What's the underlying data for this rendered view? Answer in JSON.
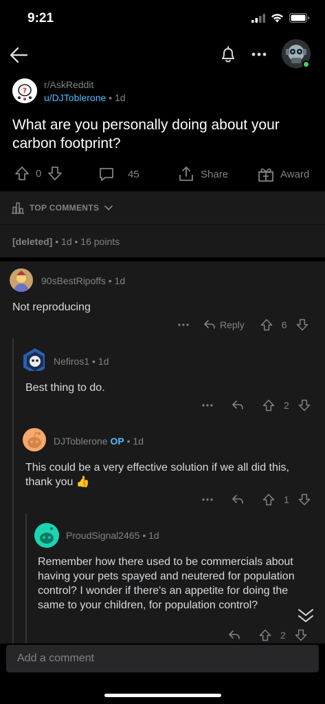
{
  "status": {
    "time": "9:21"
  },
  "post": {
    "subreddit": "r/AskReddit",
    "author": "u/DJToblerone",
    "age": "1d",
    "title": "What are you personally doing about your carbon footprint?",
    "votes": "0",
    "comments_count": "45",
    "share_label": "Share",
    "award_label": "Award"
  },
  "sort": {
    "label": "TOP COMMENTS"
  },
  "deleted_comment": {
    "author": "[deleted]",
    "age": "1d",
    "points": "16 points"
  },
  "comments": [
    {
      "author": "90sBestRipoffs",
      "age": "1d",
      "body": "Not reproducing",
      "reply_label": "Reply",
      "votes": "6"
    },
    {
      "author": "Nefiros1",
      "age": "1d",
      "body": "Best thing to do.",
      "votes": "2"
    },
    {
      "author": "DJToblerone",
      "op_badge": "OP",
      "age": "1d",
      "body": "This could be a very effective solution if we all did this, thank you 👍",
      "votes": "1"
    },
    {
      "author": "ProudSignal2465",
      "age": "1d",
      "body": "Remember how there used to be commercials about having your pets spayed and neutered for population control?  I wonder if there's an appetite for doing the same to your children, for population control?",
      "votes": "2"
    }
  ],
  "composer": {
    "placeholder": "Add a comment"
  },
  "colors": {
    "background": "#000000",
    "surface": "#1a1a1b",
    "link_blue": "#4fbcff",
    "muted": "#818384",
    "text": "#d7dadc"
  },
  "icons": [
    "back-arrow-icon",
    "bell-icon",
    "more-icon",
    "upvote-icon",
    "downvote-icon",
    "comment-icon",
    "share-icon",
    "award-icon",
    "sort-icon",
    "chevron-down-icon",
    "reply-icon",
    "scroll-down-icon"
  ]
}
